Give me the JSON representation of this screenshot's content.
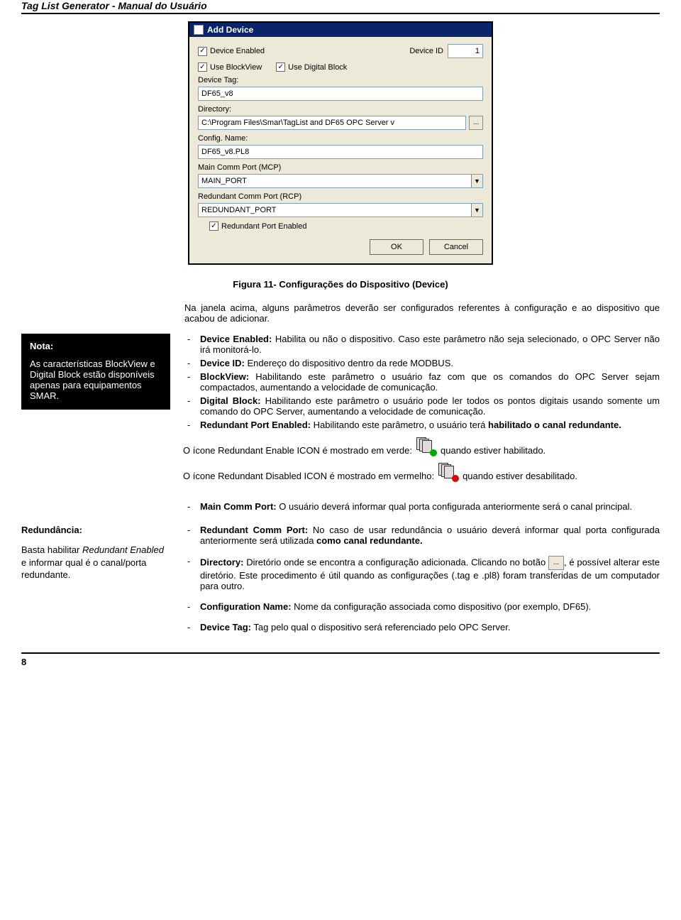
{
  "header": {
    "title": "Tag List Generator - Manual do Usuário"
  },
  "dialog": {
    "title": "Add Device",
    "device_enabled_label": "Device Enabled",
    "device_id_label": "Device ID",
    "device_id_value": "1",
    "use_blockview_label": "Use BlockView",
    "use_digital_block_label": "Use Digital Block",
    "device_tag_label": "Device Tag:",
    "device_tag_value": "DF65_v8",
    "directory_label": "Directory:",
    "directory_value": "C:\\Program Files\\Smar\\TagList and DF65 OPC Server v",
    "browse_btn": "...",
    "config_name_label": "Config. Name:",
    "config_name_value": "DF65_v8.PL8",
    "mcp_label": "Main Comm Port (MCP)",
    "mcp_value": "MAIN_PORT",
    "rcp_label": "Redundant Comm Port (RCP)",
    "rcp_value": "REDUNDANT_PORT",
    "redundant_enabled_label": "Redundant Port Enabled",
    "ok": "OK",
    "cancel": "Cancel"
  },
  "caption": "Figura 11- Configurações do Dispositivo (Device)",
  "intro": "Na janela acima, alguns parâmetros deverão ser configurados referentes à configuração e ao dispositivo que acabou de adicionar.",
  "note1": {
    "head": "Nota:",
    "body": "As características BlockView e Digital Block estão disponíveis apenas para equipamentos SMAR."
  },
  "bullets": {
    "b1_strong": "Device Enabled:",
    "b1_text": " Habilita ou não o dispositivo. Caso este parâmetro não seja selecionado, o OPC Server não irá monitorá-lo.",
    "b2_strong": "Device ID:",
    "b2_text": "  Endereço do dispositivo dentro da rede MODBUS.",
    "b3_strong": "BlockView:",
    "b3_text": " Habilitando este parâmetro o usuário faz com que os comandos do OPC Server sejam compactados, aumentando a velocidade de comunicação.",
    "b4_strong": "Digital Block:",
    "b4_text": " Habilitando este parâmetro o usuário pode ler todos os pontos digitais usando somente um comando do OPC Server, aumentando a velocidade de comunicação.",
    "b5_strong": "Redundant Port Enabled:",
    "b5_text": " Habilitando este parâmetro, o usuário terá ",
    "b5_strong2": "habilitado o canal redundante."
  },
  "icon_lines": {
    "l1_pre": "O ícone Redundant Enable ICON é mostrado em verde:",
    "l1_post": "quando estiver habilitado.",
    "l2_pre": "O ícone Redundant Disabled ICON é mostrado em vermelho:",
    "l2_post": "quando estiver desabilitado."
  },
  "bullets2": {
    "main_comm_strong": "Main Comm Port:",
    "main_comm_text": " O usuário deverá informar qual porta configurada anteriormente será o canal principal.",
    "redund_comm_strong": "Redundant Comm Port:",
    "redund_comm_text": " No caso de usar redundância o usuário deverá informar qual porta configurada anteriormente será utilizada ",
    "redund_comm_strong2": "como canal redundante.",
    "dir_strong": "Directory:",
    "dir_text_pre": " Diretório onde se encontra a configuração adicionada. Clicando no botão ",
    "dir_text_post": ", é possível alterar este diretório. Este procedimento é útil quando as configurações (.tag e .pl8) foram transferidas de um computador para outro.",
    "conf_strong": "Configuration Name:",
    "conf_text": " Nome da configuração associada como dispositivo (por exemplo, DF65).",
    "tag_strong": "Device Tag:",
    "tag_text": " Tag pelo qual o dispositivo será referenciado pelo OPC Server."
  },
  "note2": {
    "head": "Redundância:",
    "body_pre": "Basta habilitar ",
    "body_em": "Redundant Enabled",
    "body_post": " e informar qual é o canal/porta redundante."
  },
  "pagenum": "8"
}
